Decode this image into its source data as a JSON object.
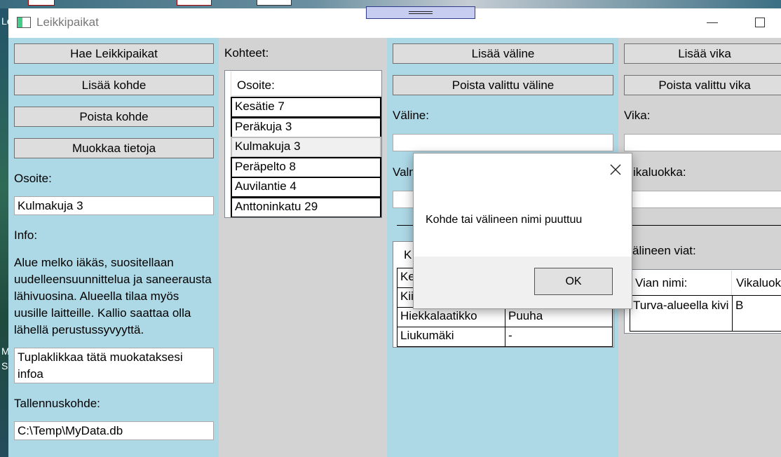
{
  "window": {
    "title": "Leikkipaikat"
  },
  "desktop_letters": [
    "Le",
    "M",
    "S"
  ],
  "left_panel": {
    "buttons": [
      "Hae Leikkipaikat",
      "Lisää kohde",
      "Poista kohde",
      "Muokkaa tietoja"
    ],
    "address_label": "Osoite:",
    "address_value": "Kulmakuja 3",
    "info_label": "Info:",
    "info_text": "Alue melko iäkäs, suositellaan uudelleensuunnittelua ja saneerausta lähivuosina. Alueella tilaa myös uusille laitteille. Kallio saattaa olla lähellä perustussyvyyttä.",
    "info_edit": "Tuplaklikkaa tätä muokataksesi infoa",
    "save_label": "Tallennuskohde:",
    "save_path": "C:\\Temp\\MyData.db"
  },
  "targets_panel": {
    "label": "Kohteet:",
    "header": "Osoite:",
    "items": [
      "Kesätie 7",
      "Peräkuja 3",
      "Kulmakuja 3",
      "Peräpelto 8",
      "Auvilantie 4",
      "Anttoninkatu 29"
    ],
    "selected_index": 2
  },
  "equipment_panel": {
    "add_button": "Lisää väline",
    "remove_button": "Poista valittu väline",
    "equipment_label": "Väline:",
    "equipment_value": "",
    "second_label_partial": "Valm",
    "second_value": "",
    "grid_header_partial": "K",
    "grid_rows": [
      {
        "c1": "Ke",
        "c2": ""
      },
      {
        "c1": "Kii",
        "c2": ""
      },
      {
        "c1": "Hiekkalaatikko",
        "c2": "Puuha"
      },
      {
        "c1": "Liukumäki",
        "c2": "-"
      }
    ]
  },
  "fault_panel": {
    "add_button": "Lisää vika",
    "remove_button": "Poista valittu vika",
    "fault_label": "Vika:",
    "fault_value": "",
    "class_label_partial": "ikaluokka:",
    "class_value": "",
    "faults_label_partial": "älineen viat:",
    "grid_headers": [
      "Vian nimi:",
      "Vikaluok"
    ],
    "grid_rows": [
      {
        "name": "Turva-alueella kivi",
        "class": "B"
      }
    ]
  },
  "dialog": {
    "message": "Kohde tai välineen nimi puuttuu",
    "ok_label": "OK"
  },
  "colors": {
    "panel_blue": "#ADD8E6",
    "panel_gray": "#D3D3D3"
  }
}
